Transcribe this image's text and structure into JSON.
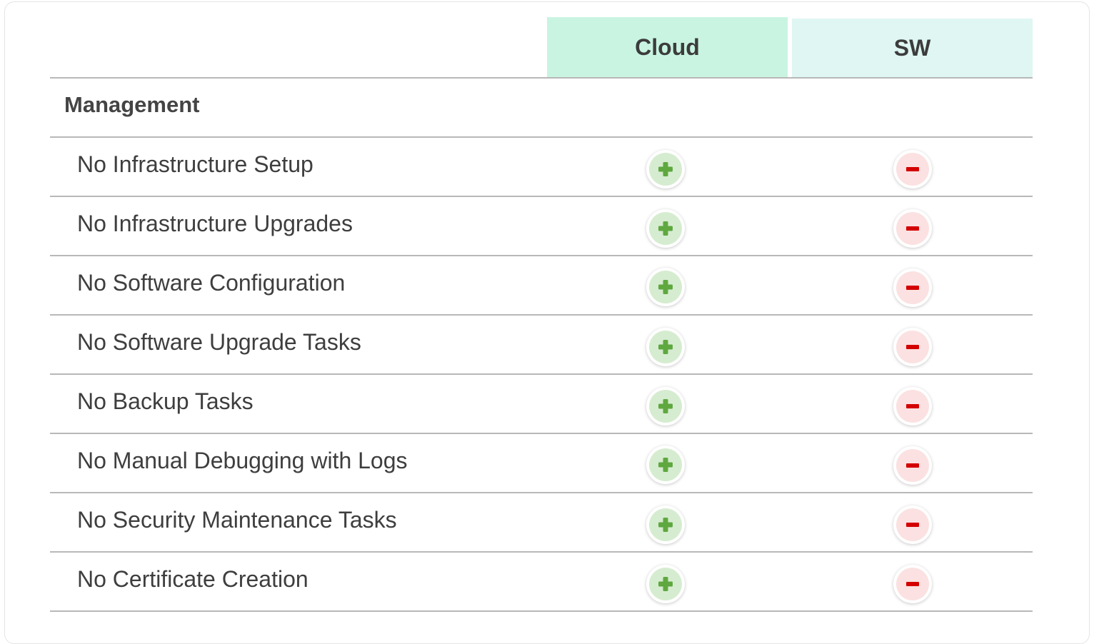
{
  "columns": {
    "cloud": "Cloud",
    "sw": "SW"
  },
  "colors": {
    "cloud_header_bg": "#c9f4e2",
    "sw_header_bg": "#dff6f2",
    "plus_color": "#5fa840",
    "plus_bg": "#d6ecd0",
    "minus_color": "#d40000",
    "minus_bg": "#fbe1e1"
  },
  "section": {
    "title": "Management"
  },
  "rows": [
    {
      "label": "No Infrastructure Setup",
      "cloud": "plus-icon",
      "sw": "minus-icon"
    },
    {
      "label": "No Infrastructure Upgrades",
      "cloud": "plus-icon",
      "sw": "minus-icon"
    },
    {
      "label": "No Software Configuration",
      "cloud": "plus-icon",
      "sw": "minus-icon"
    },
    {
      "label": "No Software Upgrade Tasks",
      "cloud": "plus-icon",
      "sw": "minus-icon"
    },
    {
      "label": "No Backup Tasks",
      "cloud": "plus-icon",
      "sw": "minus-icon"
    },
    {
      "label": "No Manual Debugging with Logs",
      "cloud": "plus-icon",
      "sw": "minus-icon"
    },
    {
      "label": "No Security Maintenance Tasks",
      "cloud": "plus-icon",
      "sw": "minus-icon"
    },
    {
      "label": "No Certificate Creation",
      "cloud": "plus-icon",
      "sw": "minus-icon"
    }
  ]
}
